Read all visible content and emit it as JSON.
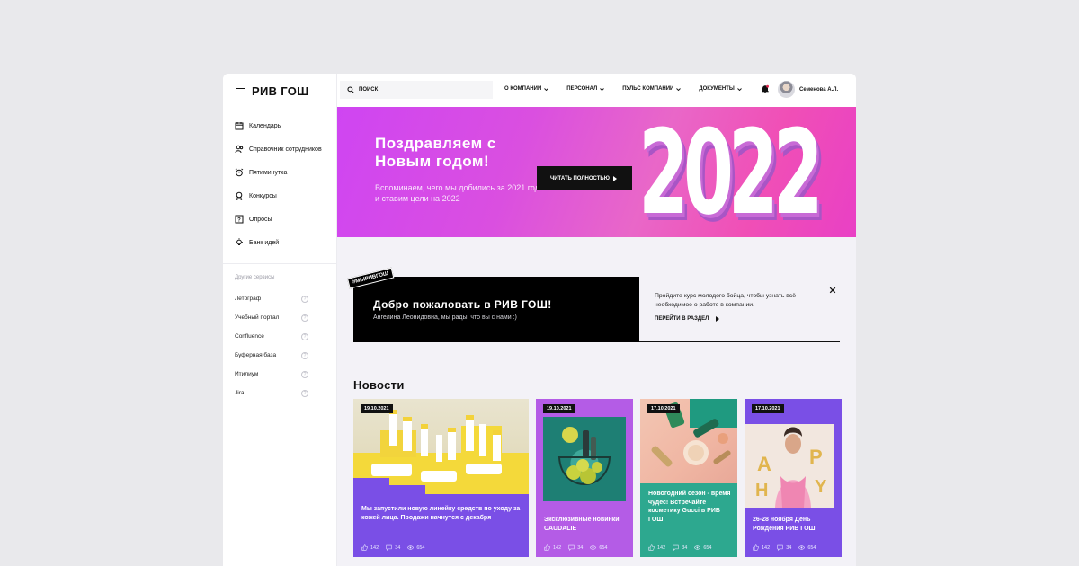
{
  "brand": {
    "logo": "РИВ ГОШ"
  },
  "sidebar": {
    "items": [
      {
        "label": "Календарь",
        "icon": "calendar-icon"
      },
      {
        "label": "Справочник сотрудников",
        "icon": "people-icon"
      },
      {
        "label": "Пятиминутка",
        "icon": "alarm-clock-icon"
      },
      {
        "label": "Конкурсы",
        "icon": "medal-icon"
      },
      {
        "label": "Опросы",
        "icon": "question-box-icon"
      },
      {
        "label": "Банк идей",
        "icon": "lightbulb-icon"
      }
    ],
    "other_title": "Другие сервисы",
    "services": [
      "Летограф",
      "Учебный портал",
      "Confluence",
      "Буферная база",
      "Итилиум",
      "Jira"
    ],
    "service_icon_glyph": "?"
  },
  "header": {
    "search_placeholder": "ПОИСК",
    "menu": [
      "О КОМПАНИИ",
      "ПЕРСОНАЛ",
      "ПУЛЬС КОМПАНИИ",
      "ДОКУМЕНТЫ"
    ],
    "user_name": "Семенова А.Л."
  },
  "hero": {
    "title": "Поздравляем с Новым годом!",
    "subtitle": "Вспоминаем, чего мы добились за 2021 год и ставим цели на 2022",
    "button": "ЧИТАТЬ ПОЛНОСТЬЮ",
    "year": "2022",
    "colors": {
      "from": "#cf45f2",
      "to": "#f04fb6"
    }
  },
  "welcome": {
    "tag": "#МЫРИВГОШ",
    "title": "Добро пожаловать в РИВ ГОШ!",
    "subtitle": "Ангелина Леонидовна, мы рады, что вы с нами :)",
    "text": "Пройдите курс молодого бойца, чтобы узнать всё необходимое о работе в компании.",
    "link": "ПЕРЕЙТИ В РАЗДЕЛ"
  },
  "news": {
    "title": "Новости",
    "cards": [
      {
        "date": "19.10.2021",
        "caption": "Мы запустили новую линейку средств по уходу за кожей лица. Продажи начнутся с декабря",
        "likes": "142",
        "comments": "34",
        "views": "654",
        "color": "#7a4fe6"
      },
      {
        "date": "19.10.2021",
        "caption": "Эксклюзивные новинки CAUDALIE",
        "likes": "142",
        "comments": "34",
        "views": "654",
        "color": "#b45ce6"
      },
      {
        "date": "17.10.2021",
        "caption": "Новогодний сезон - время чудес! Встречайте косметику Gucci в РИВ ГОШ!",
        "likes": "142",
        "comments": "34",
        "views": "654",
        "color": "#2da88f"
      },
      {
        "date": "17.10.2021",
        "caption": "26-28 ноября День Рождения РИВ ГОШ",
        "likes": "142",
        "comments": "34",
        "views": "654",
        "color": "#7a4fe6"
      }
    ]
  }
}
